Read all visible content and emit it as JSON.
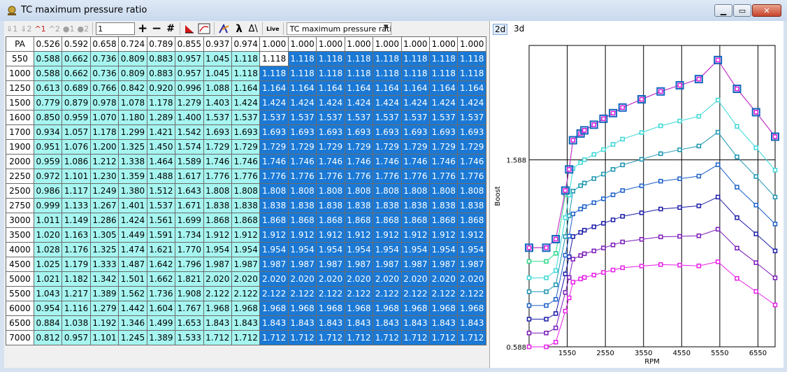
{
  "window": {
    "title": "TC maximum pressure ratio",
    "buttons": {
      "minimize": "▁",
      "maximize": "▭",
      "close": "✕"
    }
  },
  "toolbar": {
    "labels": {
      "g1": "1",
      "g2": "2",
      "r1": "1",
      "r2": "2",
      "c1": "1",
      "c2": "2",
      "plus": "+",
      "minus": "−",
      "hash": "#",
      "lambda": "λ",
      "delta": "Δ\\",
      "live": "Live"
    },
    "step_value": "1",
    "map_select": "TC maximum pressure ratio"
  },
  "table": {
    "corner": "PA",
    "columns": [
      "0.526",
      "0.592",
      "0.658",
      "0.724",
      "0.789",
      "0.855",
      "0.937",
      "0.974",
      "1.000",
      "1.000",
      "1.000",
      "1.000",
      "1.000",
      "1.000",
      "1.000",
      "1.000"
    ],
    "rows": [
      {
        "label": "550",
        "values": [
          "0.588",
          "0.662",
          "0.736",
          "0.809",
          "0.883",
          "0.957",
          "1.045",
          "1.118",
          "1.118",
          "1.118",
          "1.118",
          "1.118",
          "1.118",
          "1.118",
          "1.118",
          "1.118"
        ]
      },
      {
        "label": "1000",
        "values": [
          "0.588",
          "0.662",
          "0.736",
          "0.809",
          "0.883",
          "0.957",
          "1.045",
          "1.118",
          "1.118",
          "1.118",
          "1.118",
          "1.118",
          "1.118",
          "1.118",
          "1.118",
          "1.118"
        ]
      },
      {
        "label": "1250",
        "values": [
          "0.613",
          "0.689",
          "0.766",
          "0.842",
          "0.920",
          "0.996",
          "1.088",
          "1.164",
          "1.164",
          "1.164",
          "1.164",
          "1.164",
          "1.164",
          "1.164",
          "1.164",
          "1.164"
        ]
      },
      {
        "label": "1500",
        "values": [
          "0.779",
          "0.879",
          "0.978",
          "1.078",
          "1.178",
          "1.279",
          "1.403",
          "1.424",
          "1.424",
          "1.424",
          "1.424",
          "1.424",
          "1.424",
          "1.424",
          "1.424",
          "1.424"
        ]
      },
      {
        "label": "1600",
        "values": [
          "0.850",
          "0.959",
          "1.070",
          "1.180",
          "1.289",
          "1.400",
          "1.537",
          "1.537",
          "1.537",
          "1.537",
          "1.537",
          "1.537",
          "1.537",
          "1.537",
          "1.537",
          "1.537"
        ]
      },
      {
        "label": "1700",
        "values": [
          "0.934",
          "1.057",
          "1.178",
          "1.299",
          "1.421",
          "1.542",
          "1.693",
          "1.693",
          "1.693",
          "1.693",
          "1.693",
          "1.693",
          "1.693",
          "1.693",
          "1.693",
          "1.693"
        ]
      },
      {
        "label": "1900",
        "values": [
          "0.951",
          "1.076",
          "1.200",
          "1.325",
          "1.450",
          "1.574",
          "1.729",
          "1.729",
          "1.729",
          "1.729",
          "1.729",
          "1.729",
          "1.729",
          "1.729",
          "1.729",
          "1.729"
        ]
      },
      {
        "label": "2000",
        "values": [
          "0.959",
          "1.086",
          "1.212",
          "1.338",
          "1.464",
          "1.589",
          "1.746",
          "1.746",
          "1.746",
          "1.746",
          "1.746",
          "1.746",
          "1.746",
          "1.746",
          "1.746",
          "1.746"
        ]
      },
      {
        "label": "2250",
        "values": [
          "0.972",
          "1.101",
          "1.230",
          "1.359",
          "1.488",
          "1.617",
          "1.776",
          "1.776",
          "1.776",
          "1.776",
          "1.776",
          "1.776",
          "1.776",
          "1.776",
          "1.776",
          "1.776"
        ]
      },
      {
        "label": "2500",
        "values": [
          "0.986",
          "1.117",
          "1.249",
          "1.380",
          "1.512",
          "1.643",
          "1.808",
          "1.808",
          "1.808",
          "1.808",
          "1.808",
          "1.808",
          "1.808",
          "1.808",
          "1.808",
          "1.808"
        ]
      },
      {
        "label": "2750",
        "values": [
          "0.999",
          "1.133",
          "1.267",
          "1.401",
          "1.537",
          "1.671",
          "1.838",
          "1.838",
          "1.838",
          "1.838",
          "1.838",
          "1.838",
          "1.838",
          "1.838",
          "1.838",
          "1.838"
        ]
      },
      {
        "label": "3000",
        "values": [
          "1.011",
          "1.149",
          "1.286",
          "1.424",
          "1.561",
          "1.699",
          "1.868",
          "1.868",
          "1.868",
          "1.868",
          "1.868",
          "1.868",
          "1.868",
          "1.868",
          "1.868",
          "1.868"
        ]
      },
      {
        "label": "3500",
        "values": [
          "1.020",
          "1.163",
          "1.305",
          "1.449",
          "1.591",
          "1.734",
          "1.912",
          "1.912",
          "1.912",
          "1.912",
          "1.912",
          "1.912",
          "1.912",
          "1.912",
          "1.912",
          "1.912"
        ]
      },
      {
        "label": "4000",
        "values": [
          "1.028",
          "1.176",
          "1.325",
          "1.474",
          "1.621",
          "1.770",
          "1.954",
          "1.954",
          "1.954",
          "1.954",
          "1.954",
          "1.954",
          "1.954",
          "1.954",
          "1.954",
          "1.954"
        ]
      },
      {
        "label": "4500",
        "values": [
          "1.025",
          "1.179",
          "1.333",
          "1.487",
          "1.642",
          "1.796",
          "1.987",
          "1.987",
          "1.987",
          "1.987",
          "1.987",
          "1.987",
          "1.987",
          "1.987",
          "1.987",
          "1.987"
        ]
      },
      {
        "label": "5000",
        "values": [
          "1.021",
          "1.182",
          "1.342",
          "1.501",
          "1.662",
          "1.821",
          "2.020",
          "2.020",
          "2.020",
          "2.020",
          "2.020",
          "2.020",
          "2.020",
          "2.020",
          "2.020",
          "2.020"
        ]
      },
      {
        "label": "5500",
        "values": [
          "1.043",
          "1.217",
          "1.389",
          "1.562",
          "1.736",
          "1.908",
          "2.122",
          "2.122",
          "2.122",
          "2.122",
          "2.122",
          "2.122",
          "2.122",
          "2.122",
          "2.122",
          "2.122"
        ]
      },
      {
        "label": "6000",
        "values": [
          "0.954",
          "1.116",
          "1.279",
          "1.442",
          "1.604",
          "1.767",
          "1.968",
          "1.968",
          "1.968",
          "1.968",
          "1.968",
          "1.968",
          "1.968",
          "1.968",
          "1.968",
          "1.968"
        ]
      },
      {
        "label": "6500",
        "values": [
          "0.884",
          "1.038",
          "1.192",
          "1.346",
          "1.499",
          "1.653",
          "1.843",
          "1.843",
          "1.843",
          "1.843",
          "1.843",
          "1.843",
          "1.843",
          "1.843",
          "1.843",
          "1.843"
        ]
      },
      {
        "label": "7000",
        "values": [
          "0.812",
          "0.957",
          "1.101",
          "1.245",
          "1.389",
          "1.533",
          "1.712",
          "1.712",
          "1.712",
          "1.712",
          "1.712",
          "1.712",
          "1.712",
          "1.712",
          "1.712",
          "1.712"
        ]
      }
    ],
    "selected_cell": {
      "row": 0,
      "col": 8
    },
    "highlight_from_col": 8
  },
  "view_tabs": {
    "tab_2d": "2d",
    "tab_3d": "3d",
    "active": "2d"
  },
  "chart_data": {
    "type": "line",
    "xlabel": "RPM",
    "ylabel": "Boost",
    "x_ticks": [
      "1550",
      "2550",
      "3550",
      "4550",
      "5550",
      "6550"
    ],
    "y_ticks": [
      "0.588",
      "1.588"
    ],
    "xlim": [
      550,
      7000
    ],
    "ylim": [
      0.588,
      2.2
    ],
    "x": [
      550,
      1000,
      1250,
      1500,
      1600,
      1700,
      1900,
      2000,
      2250,
      2500,
      2750,
      3000,
      3500,
      4000,
      4500,
      5000,
      5500,
      6000,
      6500,
      7000
    ],
    "series": [
      {
        "color": "#e61ee6",
        "values": [
          0.588,
          0.588,
          0.613,
          0.779,
          0.85,
          0.934,
          0.951,
          0.959,
          0.972,
          0.986,
          0.999,
          1.011,
          1.02,
          1.028,
          1.025,
          1.021,
          1.043,
          0.954,
          0.884,
          0.812
        ]
      },
      {
        "color": "#7a19b8",
        "values": [
          0.662,
          0.662,
          0.689,
          0.879,
          0.959,
          1.057,
          1.076,
          1.086,
          1.101,
          1.117,
          1.133,
          1.149,
          1.163,
          1.176,
          1.179,
          1.182,
          1.217,
          1.116,
          1.038,
          0.957
        ]
      },
      {
        "color": "#1a1aa8",
        "values": [
          0.736,
          0.736,
          0.766,
          0.978,
          1.07,
          1.178,
          1.2,
          1.212,
          1.23,
          1.249,
          1.267,
          1.286,
          1.305,
          1.325,
          1.333,
          1.342,
          1.389,
          1.279,
          1.192,
          1.101
        ]
      },
      {
        "color": "#1a5ec8",
        "values": [
          0.809,
          0.809,
          0.842,
          1.078,
          1.18,
          1.299,
          1.325,
          1.338,
          1.359,
          1.38,
          1.401,
          1.424,
          1.449,
          1.474,
          1.487,
          1.501,
          1.562,
          1.442,
          1.346,
          1.245
        ]
      },
      {
        "color": "#1893b0",
        "values": [
          0.883,
          0.883,
          0.92,
          1.178,
          1.289,
          1.421,
          1.45,
          1.464,
          1.488,
          1.512,
          1.537,
          1.561,
          1.591,
          1.621,
          1.642,
          1.662,
          1.736,
          1.604,
          1.499,
          1.389
        ]
      },
      {
        "color": "#3cd7d7",
        "values": [
          0.957,
          0.957,
          0.996,
          1.279,
          1.4,
          1.542,
          1.574,
          1.589,
          1.617,
          1.643,
          1.671,
          1.699,
          1.734,
          1.77,
          1.796,
          1.821,
          1.908,
          1.767,
          1.653,
          1.533
        ]
      },
      {
        "color": "#31d88c",
        "values": [
          1.045,
          1.045,
          1.088,
          1.403,
          1.537,
          1.693,
          1.729,
          1.746,
          1.776,
          1.808,
          1.838,
          1.868,
          1.912,
          1.954,
          1.987,
          2.02,
          2.122,
          1.968,
          1.843,
          1.712
        ]
      },
      {
        "color": "#22a822",
        "values": [
          1.118,
          1.118,
          1.164,
          1.424,
          1.537,
          1.693,
          1.729,
          1.746,
          1.776,
          1.808,
          1.838,
          1.868,
          1.912,
          1.954,
          1.987,
          2.02,
          2.122,
          1.968,
          1.843,
          1.712
        ]
      },
      {
        "color": "#e61ee6",
        "values": [
          1.118,
          1.118,
          1.164,
          1.424,
          1.537,
          1.693,
          1.729,
          1.746,
          1.776,
          1.808,
          1.838,
          1.868,
          1.912,
          1.954,
          1.987,
          2.02,
          2.122,
          1.968,
          1.843,
          1.712
        ],
        "highlighted": true
      }
    ],
    "grid": true
  }
}
